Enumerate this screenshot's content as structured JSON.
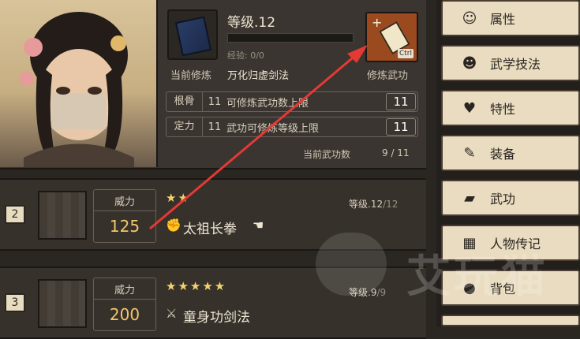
{
  "character": {
    "level_text": "等级.12",
    "xp_text": "经验: 0/0",
    "current_label": "当前修炼",
    "current_value": "万化归虚剑法",
    "skill_caption": "修炼武功",
    "ctrl_hint": "Ctrl",
    "stats": [
      {
        "name": "根骨",
        "value": "11",
        "desc": "可修炼武功数上限",
        "boxed": "11"
      },
      {
        "name": "定力",
        "value": "11",
        "desc": "武功可修炼等级上限",
        "boxed": "11"
      }
    ],
    "count_label": "当前武功数",
    "count_value": "9 / 11"
  },
  "skills": [
    {
      "index": "2",
      "power_label": "威力",
      "power": "125",
      "stars": "★★",
      "name": "太祖长拳",
      "level": "等级.12",
      "level_max": "/12"
    },
    {
      "index": "3",
      "power_label": "威力",
      "power": "200",
      "stars": "★★★★★",
      "name": "童身功剑法",
      "level": "等级.9",
      "level_max": "/9"
    }
  ],
  "menu": [
    {
      "label": "属性",
      "icon": "person-icon",
      "glyph": "☺"
    },
    {
      "label": "武学技法",
      "icon": "martial-icon",
      "glyph": "☻"
    },
    {
      "label": "特性",
      "icon": "trait-icon",
      "glyph": "♥"
    },
    {
      "label": "装备",
      "icon": "sword-icon",
      "glyph": "✎"
    },
    {
      "label": "武功",
      "icon": "book-icon",
      "glyph": "▰"
    },
    {
      "label": "人物传记",
      "icon": "scroll-icon",
      "glyph": "▦"
    },
    {
      "label": "背包",
      "icon": "bag-icon",
      "glyph": "●"
    }
  ],
  "watermark": "艾玩猫",
  "colors": {
    "accent": "#f4c76a",
    "arrow": "#e53935",
    "menu_bg": "#e9dcc0"
  }
}
